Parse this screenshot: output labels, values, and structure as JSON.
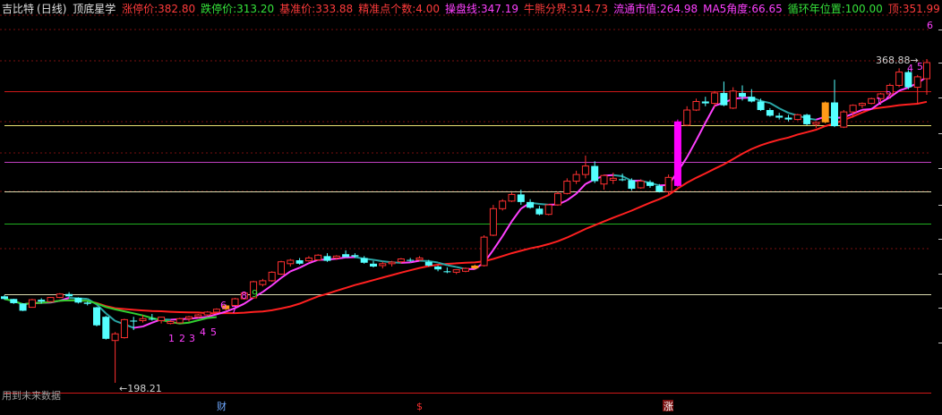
{
  "header": {
    "title": "吉比特",
    "period": "(日线)",
    "indicator_name": "顶底星学",
    "fields": [
      {
        "label": "涨停价:",
        "value": "382.80",
        "color": "#ff3b3b"
      },
      {
        "label": "跌停价:",
        "value": "313.20",
        "color": "#36e23a"
      },
      {
        "label": "基准价:",
        "value": "333.88",
        "color": "#ff3b3b"
      },
      {
        "label": "精准点个数:",
        "value": "4.00",
        "color": "#ff3b3b"
      },
      {
        "label": "操盘线:",
        "value": "347.19",
        "color": "#ff40ff"
      },
      {
        "label": "牛熊分界:",
        "value": "314.73",
        "color": "#ff3b3b"
      },
      {
        "label": "流通市值:",
        "value": "264.98",
        "color": "#ff40ff"
      },
      {
        "label": "MA5角度:",
        "value": "66.65",
        "color": "#ff40ff"
      },
      {
        "label": "循环年位置:",
        "value": "100.00",
        "color": "#36e23a"
      },
      {
        "label": "顶:",
        "value": "351.99",
        "color": "#ff3b3b"
      }
    ]
  },
  "annotations": {
    "high_price": "368.88",
    "low_price": "198.21",
    "future_data_note": "用到未来数据",
    "top_digit": "6",
    "seq_left": [
      "1",
      "2",
      "3",
      "4",
      "5",
      "6",
      "7",
      "8",
      "9"
    ],
    "seq_right": [
      "1",
      "2",
      "4",
      "5"
    ]
  },
  "markers": {
    "cai": "财",
    "dollar": "$",
    "zhang": "涨"
  },
  "colors": {
    "background": "#000000",
    "up": "#ff3030",
    "down": "#54ffff",
    "orange": "#ff9a18",
    "magenta_bar": "#ff00ff",
    "ma_red": "#ff2020",
    "ma_pink": "#ff40ff",
    "ma_teal": "#2aa6a6",
    "ma_green": "#30d030",
    "line_yellow": "#e8e070",
    "line_magenta": "#c040c0",
    "line_green": "#20b020",
    "line_white": "#dcdcb0",
    "line_red": "#d01818"
  },
  "chart_data": {
    "type": "candlestick",
    "title": "吉比特 (日线)",
    "price_low_marked": 198.21,
    "price_high_marked": 368.88,
    "horizontal_levels": [
      {
        "price": 351.99,
        "color": "red"
      },
      {
        "price": 333.88,
        "color": "yellow"
      },
      {
        "price": 314.73,
        "color": "magenta"
      },
      {
        "price": 299.0,
        "color": "white"
      },
      {
        "price": 282.0,
        "color": "green"
      },
      {
        "price": 245.0,
        "color": "white"
      },
      {
        "price": 193.0,
        "color": "red"
      }
    ],
    "candles": [
      [
        243.8,
        244.5,
        242.0,
        242.4
      ],
      [
        242.4,
        242.5,
        239.8,
        240.2
      ],
      [
        240.0,
        240.2,
        236.0,
        236.2
      ],
      [
        238.0,
        242.5,
        237.8,
        242.0
      ],
      [
        242.0,
        242.8,
        240.0,
        241.0
      ],
      [
        241.0,
        243.5,
        240.8,
        243.2
      ],
      [
        243.2,
        245.5,
        242.8,
        245.0
      ],
      [
        245.0,
        246.0,
        243.5,
        243.8
      ],
      [
        243.0,
        243.3,
        240.0,
        240.5
      ],
      [
        240.5,
        241.0,
        239.0,
        239.8
      ],
      [
        238.0,
        238.2,
        228.0,
        228.5
      ],
      [
        233.0,
        233.5,
        221.0,
        221.4
      ],
      [
        220.5,
        225.0,
        198.21,
        224.0
      ],
      [
        222.0,
        232.0,
        221.5,
        231.5
      ],
      [
        231.0,
        233.0,
        226.0,
        230.5
      ],
      [
        231.0,
        234.0,
        230.0,
        232.0
      ],
      [
        232.0,
        234.5,
        231.0,
        231.5
      ],
      [
        231.0,
        233.0,
        229.5,
        232.8
      ],
      [
        229.5,
        231.2,
        229.0,
        230.5
      ],
      [
        229.8,
        232.5,
        229.5,
        232.0
      ],
      [
        232.0,
        233.5,
        230.5,
        233.0
      ],
      [
        233.0,
        234.5,
        232.5,
        234.0
      ],
      [
        234.0,
        236.0,
        233.5,
        235.5
      ],
      [
        235.5,
        237.5,
        235.0,
        237.0
      ],
      [
        237.0,
        239.5,
        236.5,
        239.0
      ],
      [
        239.0,
        243.0,
        238.5,
        242.5
      ],
      [
        242.5,
        246.0,
        242.0,
        245.5
      ],
      [
        243.0,
        252.0,
        242.5,
        251.5
      ],
      [
        250.0,
        253.0,
        249.0,
        252.0
      ],
      [
        252.0,
        257.0,
        251.5,
        256.5
      ],
      [
        255.5,
        262.5,
        255.0,
        262.0
      ],
      [
        261.0,
        263.5,
        259.5,
        262.8
      ],
      [
        262.8,
        264.0,
        260.5,
        261.0
      ],
      [
        262.5,
        265.0,
        262.0,
        264.0
      ],
      [
        263.0,
        266.0,
        262.5,
        265.5
      ],
      [
        265.0,
        266.5,
        262.0,
        262.5
      ],
      [
        264.0,
        265.5,
        263.0,
        265.0
      ],
      [
        266.0,
        268.0,
        265.0,
        264.5
      ],
      [
        265.5,
        266.5,
        264.0,
        264.8
      ],
      [
        264.0,
        265.0,
        261.0,
        261.5
      ],
      [
        261.0,
        262.5,
        259.0,
        259.5
      ],
      [
        260.0,
        262.0,
        258.5,
        261.0
      ],
      [
        261.0,
        262.5,
        259.5,
        261.8
      ],
      [
        262.0,
        264.0,
        261.0,
        263.5
      ],
      [
        263.0,
        264.0,
        262.0,
        262.5
      ],
      [
        263.0,
        265.0,
        262.5,
        264.0
      ],
      [
        262.0,
        263.0,
        259.5,
        260.0
      ],
      [
        259.5,
        260.0,
        257.0,
        258.0
      ],
      [
        257.0,
        259.0,
        256.0,
        256.5
      ],
      [
        256.5,
        258.0,
        255.5,
        257.8
      ],
      [
        257.0,
        259.0,
        256.5,
        258.5
      ],
      [
        258.5,
        260.5,
        258.0,
        260.0
      ],
      [
        260.0,
        276.0,
        259.5,
        275.0
      ],
      [
        276.0,
        292.0,
        275.5,
        290.0
      ],
      [
        290.0,
        295.0,
        289.0,
        294.0
      ],
      [
        294.0,
        298.5,
        293.5,
        297.5
      ],
      [
        297.5,
        300.0,
        292.0,
        293.5
      ],
      [
        293.5,
        295.0,
        290.0,
        290.5
      ],
      [
        290.0,
        291.5,
        286.5,
        287.0
      ],
      [
        287.0,
        292.5,
        286.5,
        292.0
      ],
      [
        292.0,
        299.0,
        291.5,
        298.0
      ],
      [
        298.0,
        306.0,
        297.5,
        304.5
      ],
      [
        304.5,
        310.0,
        303.0,
        308.0
      ],
      [
        308.0,
        318.0,
        306.0,
        312.5
      ],
      [
        312.5,
        315.0,
        303.5,
        304.5
      ],
      [
        303.0,
        308.0,
        300.0,
        307.5
      ],
      [
        305.0,
        309.0,
        303.0,
        306.0
      ],
      [
        305.5,
        308.5,
        304.5,
        305.0
      ],
      [
        305.0,
        306.0,
        299.5,
        300.5
      ],
      [
        301.0,
        305.5,
        300.5,
        304.5
      ],
      [
        304.0,
        305.0,
        301.0,
        302.0
      ],
      [
        302.0,
        303.0,
        298.5,
        299.0
      ],
      [
        299.0,
        308.0,
        297.5,
        306.5
      ],
      [
        302.0,
        337.0,
        301.5,
        336.0
      ],
      [
        334.0,
        344.0,
        333.5,
        342.0
      ],
      [
        342.0,
        348.0,
        341.5,
        346.5
      ],
      [
        346.5,
        349.0,
        344.0,
        345.5
      ],
      [
        345.5,
        352.0,
        343.5,
        351.0
      ],
      [
        351.0,
        357.0,
        344.0,
        344.5
      ],
      [
        343.0,
        354.0,
        342.5,
        352.0
      ],
      [
        351.0,
        355.0,
        347.0,
        349.0
      ],
      [
        349.0,
        353.0,
        346.0,
        346.5
      ],
      [
        346.5,
        348.0,
        341.5,
        342.0
      ],
      [
        342.0,
        343.0,
        338.5,
        339.0
      ],
      [
        339.0,
        340.5,
        337.0,
        338.0
      ],
      [
        338.0,
        339.5,
        336.0,
        337.0
      ],
      [
        337.0,
        340.0,
        336.5,
        339.5
      ],
      [
        339.5,
        340.0,
        334.0,
        334.5
      ],
      [
        334.5,
        336.0,
        332.5,
        335.5
      ],
      [
        335.5,
        346.5,
        335.0,
        346.0
      ],
      [
        346.0,
        358.0,
        333.0,
        333.5
      ],
      [
        333.0,
        342.0,
        332.5,
        341.0
      ],
      [
        341.0,
        345.0,
        338.0,
        344.5
      ],
      [
        344.5,
        346.0,
        343.0,
        345.5
      ],
      [
        345.5,
        348.5,
        345.0,
        348.0
      ],
      [
        348.0,
        351.0,
        346.0,
        350.5
      ],
      [
        350.5,
        356.0,
        348.0,
        355.0
      ],
      [
        355.0,
        364.0,
        354.0,
        362.0
      ],
      [
        362.0,
        363.0,
        353.0,
        354.0
      ],
      [
        354.0,
        360.5,
        345.0,
        359.5
      ],
      [
        358.5,
        368.88,
        350.0,
        367.0
      ]
    ],
    "series": [
      {
        "name": "操盘线",
        "values": []
      },
      {
        "name": "牛熊分界",
        "values": []
      }
    ]
  }
}
